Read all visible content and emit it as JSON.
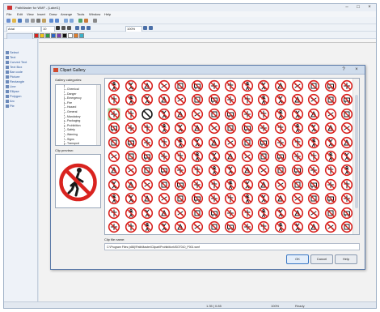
{
  "app": {
    "title": "PathMaster for WMF - [Label1]",
    "menu": [
      "File",
      "Edit",
      "View",
      "Insert",
      "Draw",
      "Arrange",
      "Tools",
      "Window",
      "Help"
    ],
    "font_combo": "Arial",
    "size_combo": "10",
    "zoom_combo": "100%",
    "window_controls": [
      "–",
      "□",
      "×"
    ]
  },
  "left_panel": {
    "items": [
      "Select",
      "Text",
      "Curved Text",
      "Text Box",
      "Bar code",
      "Picture",
      "Rectangle",
      "Line",
      "Ellipse",
      "Polygon",
      "Arc",
      "Pie"
    ]
  },
  "statusbar": {
    "coords": "1.35 | 0.85",
    "zoom": "100%",
    "info": "Ready"
  },
  "dialog": {
    "title": "Clipart Gallery",
    "categories_label": "Gallery categories:",
    "categories": [
      "Chemical",
      "Danger",
      "Emergency",
      "Fire",
      "Hazard",
      "General",
      "Mandatory",
      "Packaging",
      "Prohibition",
      "Safety",
      "Warning",
      "Signs",
      "Transport"
    ],
    "preview_label": "Clip preview:",
    "filename_label": "Clip file name:",
    "filename": "C:\\Program Files (x86)\\PathMaster\\Clipart\\Prohibition\\ISO7010_P001.wmf",
    "buttons": {
      "ok": "OK",
      "cancel": "Cancel",
      "help": "Help"
    },
    "controls": [
      "?",
      "×"
    ]
  },
  "clipart": {
    "rows": 11,
    "cols": 15,
    "selected_index": 30,
    "colors": {
      "ring": "#d9231f",
      "symbol": "#1a1a1a",
      "selected_bg": "#9fd39a"
    },
    "kinds": [
      "slash",
      "slash",
      "slash",
      "slash",
      "slash",
      "slash",
      "slash",
      "slash",
      "slash",
      "slash",
      "slash",
      "slash",
      "slash",
      "slash",
      "slash",
      "slash",
      "slash",
      "slash",
      "slash",
      "slash",
      "slash",
      "slash",
      "slash",
      "slash",
      "slash",
      "slash",
      "slash",
      "slash",
      "slash",
      "slash",
      "green",
      "slash",
      "black",
      "slash",
      "slash",
      "slash",
      "slash",
      "slash",
      "slash",
      "slash",
      "slash",
      "slash",
      "slash",
      "slash",
      "slash",
      "slash",
      "slash",
      "slash",
      "slash",
      "slash",
      "slash",
      "slash",
      "slash",
      "slash",
      "slash",
      "slash",
      "slash",
      "slash",
      "slash",
      "slash",
      "slash",
      "slash",
      "slash",
      "slash",
      "slash",
      "slash",
      "slash",
      "slash",
      "slash",
      "slash",
      "slash",
      "slash",
      "slash",
      "slash",
      "slash",
      "slash",
      "slash",
      "slash",
      "slash",
      "slash",
      "slash",
      "slash",
      "slash",
      "slash",
      "slash",
      "slash",
      "slash",
      "slash",
      "slash",
      "slash",
      "slash",
      "slash",
      "slash",
      "slash",
      "slash",
      "slash",
      "slash",
      "slash",
      "slash",
      "slash",
      "slash",
      "slash",
      "slash",
      "slash",
      "slash",
      "slash",
      "slash",
      "slash",
      "slash",
      "slash",
      "slash",
      "slash",
      "slash",
      "slash",
      "slash",
      "slash",
      "slash",
      "slash",
      "slash",
      "slash",
      "slash",
      "slash",
      "slash",
      "slash",
      "slash",
      "slash",
      "slash",
      "slash",
      "slash",
      "slash",
      "slash",
      "slash",
      "slash",
      "slash",
      "slash",
      "slash",
      "slash",
      "slash",
      "slash",
      "slash",
      "slash",
      "slash",
      "slash",
      "slash",
      "slash",
      "slash",
      "slash",
      "slash",
      "slash",
      "slash",
      "slash",
      "slash",
      "slash",
      "slash",
      "slash",
      "slash",
      "slash",
      "slash",
      "slash",
      "slash",
      "slash"
    ]
  }
}
